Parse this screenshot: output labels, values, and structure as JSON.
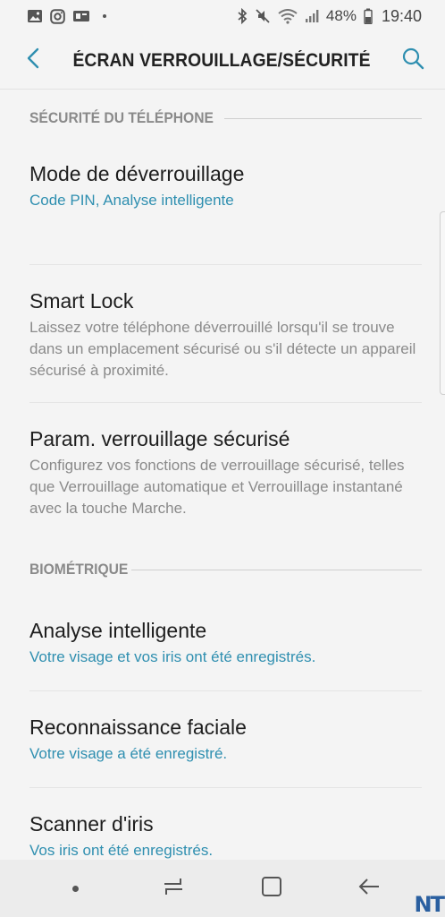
{
  "status_bar": {
    "battery_percent": "48%",
    "time": "19:40"
  },
  "header": {
    "title": "ÉCRAN VERROUILLAGE/SÉCURITÉ"
  },
  "sections": [
    {
      "label": "SÉCURITÉ DU TÉLÉPHONE",
      "items": [
        {
          "title": "Mode de déverrouillage",
          "subtitle": "Code PIN, Analyse intelligente"
        },
        {
          "title": "Smart Lock",
          "subtitle": "Laissez votre téléphone déverrouillé lorsqu'il se trouve dans un emplacement sécurisé ou s'il détecte un appareil sécurisé à proximité."
        },
        {
          "title": "Param. verrouillage sécurisé",
          "subtitle": "Configurez vos fonctions de verrouillage sécurisé, telles que Verrouillage automatique et Verrouillage instantané avec la touche Marche."
        }
      ]
    },
    {
      "label": "BIOMÉTRIQUE",
      "items": [
        {
          "title": "Analyse intelligente",
          "subtitle": "Votre visage et vos iris ont été enregistrés."
        },
        {
          "title": "Reconnaissance faciale",
          "subtitle": "Votre visage a été enregistré."
        },
        {
          "title": "Scanner d'iris",
          "subtitle": "Vos iris ont été enregistrés."
        }
      ]
    }
  ],
  "watermark": "NT",
  "colors": {
    "accent": "#2f8fb0",
    "background": "#f4f4f4",
    "section_label": "#8a8a8a"
  },
  "icons": {
    "back": "chevron-left-icon",
    "search": "search-icon",
    "nav_recents": "recents-icon",
    "nav_home": "home-icon",
    "nav_back": "back-arrow-icon"
  }
}
